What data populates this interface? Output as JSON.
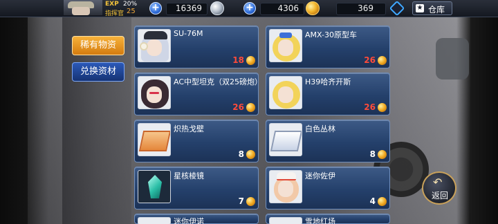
{
  "topbar": {
    "exp_label": "EXP",
    "exp_percent": "20%",
    "rank_label": "指挥官",
    "rank_level": "25",
    "resources": [
      {
        "icon": "silver-coin-icon",
        "value": "16369"
      },
      {
        "icon": "gold-coin-icon",
        "value": "4306"
      },
      {
        "icon": "core-icon",
        "value": "369"
      }
    ],
    "depot_label": "仓库"
  },
  "tabs": [
    {
      "label": "稀有物资",
      "active": true
    },
    {
      "label": "兑换资材",
      "active": false
    }
  ],
  "items": [
    {
      "name": "SU-76M",
      "count": "18",
      "count_color": "red",
      "portrait": "silver-hair-doll"
    },
    {
      "name": "AMX-30原型车",
      "count": "26",
      "count_color": "red",
      "portrait": "blonde-doll"
    },
    {
      "name": "AC中型坦克（双25磅炮）",
      "count": "26",
      "count_color": "red",
      "portrait": "dark-hair-doll"
    },
    {
      "name": "H39哈齐开斯",
      "count": "26",
      "count_color": "red",
      "portrait": "blonde-doll-2"
    },
    {
      "name": "炽热戈壁",
      "count": "8",
      "count_color": "white",
      "portrait": "desert-terrain"
    },
    {
      "name": "白色丛林",
      "count": "8",
      "count_color": "white",
      "portrait": "snow-terrain"
    },
    {
      "name": "星核棱镜",
      "count": "7",
      "count_color": "white",
      "portrait": "crystal"
    },
    {
      "name": "迷你佐伊",
      "count": "4",
      "count_color": "white",
      "portrait": "mini-doll"
    },
    {
      "name": "迷你伊诺",
      "count": "",
      "count_color": "white",
      "portrait": "mini-doll-2"
    },
    {
      "name": "雪地红场",
      "count": "",
      "count_color": "white",
      "portrait": "snow-terrain-2"
    }
  ],
  "back_button": {
    "label": "返回"
  },
  "colors": {
    "accent_orange": "#f7b23a",
    "accent_blue": "#2b59b8",
    "count_red": "#ff4b3a"
  }
}
